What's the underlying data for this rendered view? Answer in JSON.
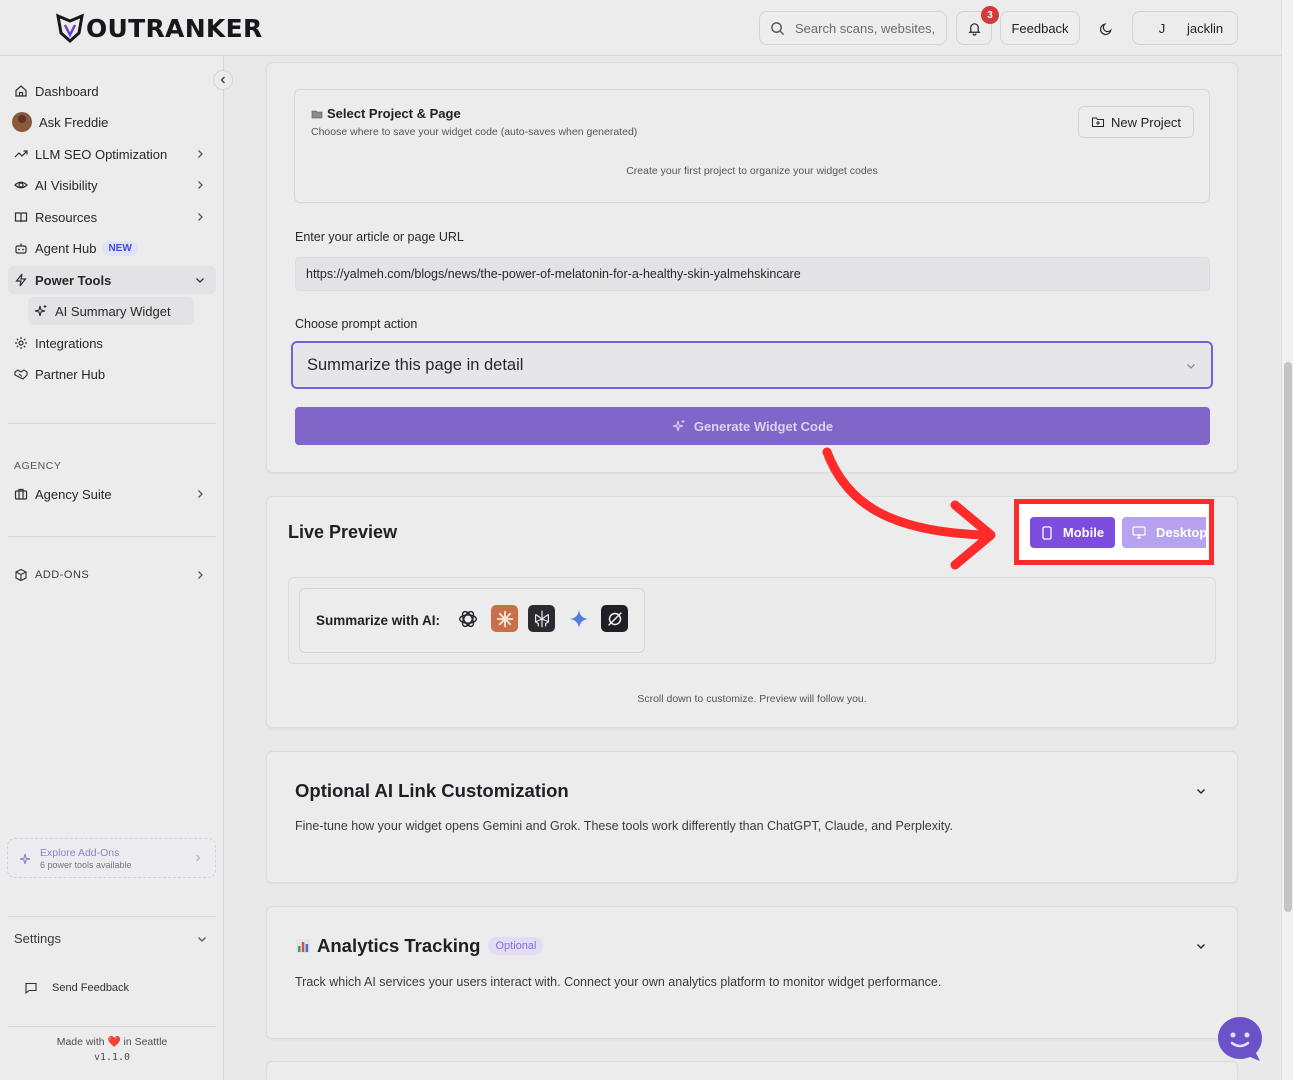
{
  "header": {
    "logo_text": "OUTRANKER",
    "search_placeholder": "Search scans, websites,",
    "notification_count": "3",
    "feedback_label": "Feedback",
    "user_initial": "J",
    "user_name": "jacklin"
  },
  "sidebar": {
    "items": [
      {
        "label": "Dashboard",
        "icon": "home-icon"
      },
      {
        "label": "Ask Freddie",
        "icon": "avatar"
      },
      {
        "label": "LLM SEO Optimization",
        "icon": "trend-icon"
      },
      {
        "label": "AI Visibility",
        "icon": "eye-icon"
      },
      {
        "label": "Resources",
        "icon": "book-icon"
      },
      {
        "label": "Agent Hub",
        "icon": "bot-icon",
        "badge": "NEW"
      },
      {
        "label": "Power Tools",
        "icon": "zap-icon"
      },
      {
        "label": "AI Summary Widget",
        "icon": "sparkle-icon"
      },
      {
        "label": "Integrations",
        "icon": "gear-icon"
      },
      {
        "label": "Partner Hub",
        "icon": "handshake-icon"
      }
    ],
    "agency_label": "AGENCY",
    "agency_item": "Agency Suite",
    "addons_label": "ADD-ONS",
    "explore_title": "Explore Add-Ons",
    "explore_sub": "6 power tools available",
    "settings_label": "Settings",
    "send_feedback": "Send Feedback",
    "made_with": "Made with ❤️ in Seattle",
    "version": "v1.1.0"
  },
  "project": {
    "title": "Select Project & Page",
    "subtitle": "Choose where to save your widget code (auto-saves when generated)",
    "new_project": "New Project",
    "empty": "Create your first project to organize your widget codes"
  },
  "form": {
    "url_label": "Enter your article or page URL",
    "url_value": "https://yalmeh.com/blogs/news/the-power-of-melatonin-for-a-healthy-skin-yalmehskincare",
    "prompt_label": "Choose prompt action",
    "prompt_value": "Summarize this page in detail",
    "generate_label": "Generate Widget Code"
  },
  "preview": {
    "title": "Live Preview",
    "mobile_label": "Mobile",
    "desktop_label": "Desktop",
    "widget_label": "Summarize with AI:",
    "ai_icons": [
      "chatgpt-icon",
      "claude-icon",
      "perplexity-icon",
      "gemini-icon",
      "grok-icon"
    ],
    "scroll_note": "Scroll down to customize. Preview will follow you."
  },
  "sections": {
    "link_title": "Optional AI Link Customization",
    "link_desc": "Fine-tune how your widget opens Gemini and Grok. These tools work differently than ChatGPT, Claude, and Perplexity.",
    "analytics_title": "Analytics Tracking",
    "analytics_badge": "Optional",
    "analytics_desc": "Track which AI services your users interact with. Connect your own analytics platform to monitor widget performance."
  },
  "colors": {
    "accent": "#7c4ddf",
    "highlight": "#ff2a2a",
    "generate": "#8066c9"
  }
}
